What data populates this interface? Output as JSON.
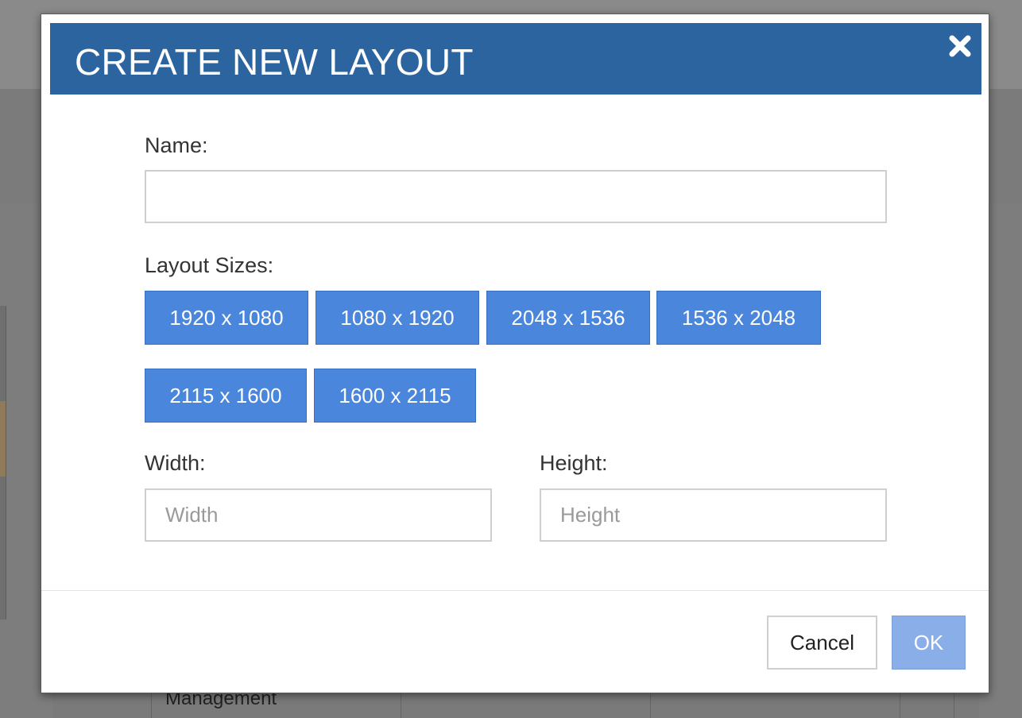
{
  "background": {
    "table_cell_text": "Management"
  },
  "dialog": {
    "title": "CREATE NEW LAYOUT",
    "close_icon": "close-icon",
    "name": {
      "label": "Name:",
      "value": "",
      "placeholder": ""
    },
    "layout_sizes": {
      "label": "Layout Sizes:",
      "options": [
        "1920 x 1080",
        "1080 x 1920",
        "2048 x 1536",
        "1536 x 2048",
        "2115 x 1600",
        "1600 x 2115"
      ]
    },
    "width": {
      "label": "Width:",
      "placeholder": "Width"
    },
    "height": {
      "label": "Height:",
      "placeholder": "Height"
    },
    "cancel_label": "Cancel",
    "ok_label": "OK"
  },
  "colors": {
    "header": "#2c64a0",
    "size_button": "#4a86dc",
    "ok_button_disabled": "#8aaee8"
  }
}
